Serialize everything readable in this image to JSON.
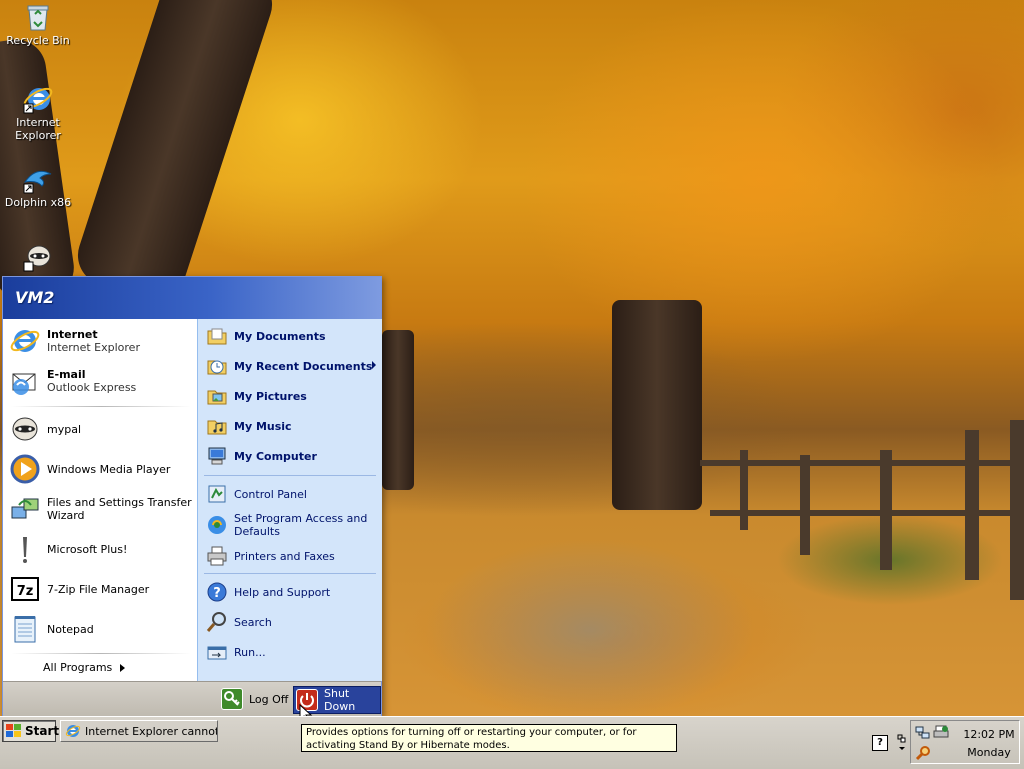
{
  "desktop": {
    "icons": [
      {
        "label": "Recycle Bin"
      },
      {
        "label": "Internet Explorer"
      },
      {
        "label": "Dolphin x86"
      },
      {
        "label": ""
      }
    ]
  },
  "start_menu": {
    "user_name": "VM2",
    "pinned": [
      {
        "title": "Internet",
        "subtitle": "Internet Explorer",
        "icon": "internet-explorer-icon"
      },
      {
        "title": "E-mail",
        "subtitle": "Outlook Express",
        "icon": "outlook-express-icon"
      }
    ],
    "recent_programs": [
      {
        "label": "mypal",
        "icon": "mypal-icon"
      },
      {
        "label": "Windows Media Player",
        "icon": "media-player-icon"
      },
      {
        "label": "Files and Settings Transfer Wizard",
        "icon": "transfer-wizard-icon"
      },
      {
        "label": "Microsoft Plus!",
        "icon": "microsoft-plus-icon"
      },
      {
        "label": "7-Zip File Manager",
        "icon": "7zip-icon"
      },
      {
        "label": "Notepad",
        "icon": "notepad-icon"
      }
    ],
    "all_programs_label": "All Programs",
    "places": [
      {
        "label": "My Documents",
        "icon": "folder-icon"
      },
      {
        "label": "My Recent Documents",
        "icon": "recent-documents-icon",
        "has_submenu": true
      },
      {
        "label": "My Pictures",
        "icon": "pictures-folder-icon"
      },
      {
        "label": "My Music",
        "icon": "music-folder-icon"
      },
      {
        "label": "My Computer",
        "icon": "computer-icon"
      }
    ],
    "settings": [
      {
        "label": "Control Panel",
        "icon": "control-panel-icon"
      },
      {
        "label": "Set Program Access and Defaults",
        "icon": "program-defaults-icon"
      },
      {
        "label": "Printers and Faxes",
        "icon": "printer-icon"
      }
    ],
    "tools": [
      {
        "label": "Help and Support",
        "icon": "help-icon"
      },
      {
        "label": "Search",
        "icon": "search-icon"
      },
      {
        "label": "Run...",
        "icon": "run-icon"
      }
    ],
    "log_off_label": "Log Off",
    "shut_down_label": "Shut Down"
  },
  "tooltip": {
    "text": "Provides options for turning off or restarting your computer, or for activating Stand By or Hibernate modes."
  },
  "taskbar": {
    "start_label": "Start",
    "task_label": "Internet Explorer cannot...",
    "help_label": "?",
    "clock_time": "12:02 PM",
    "clock_day": "Monday"
  },
  "colors": {
    "header_blue": "#1a3d9c",
    "right_pane": "#d3e5fa",
    "shutdown_red": "#c42b1c",
    "logoff_green": "#3f8a2b",
    "tooltip_bg": "#ffffe1"
  }
}
